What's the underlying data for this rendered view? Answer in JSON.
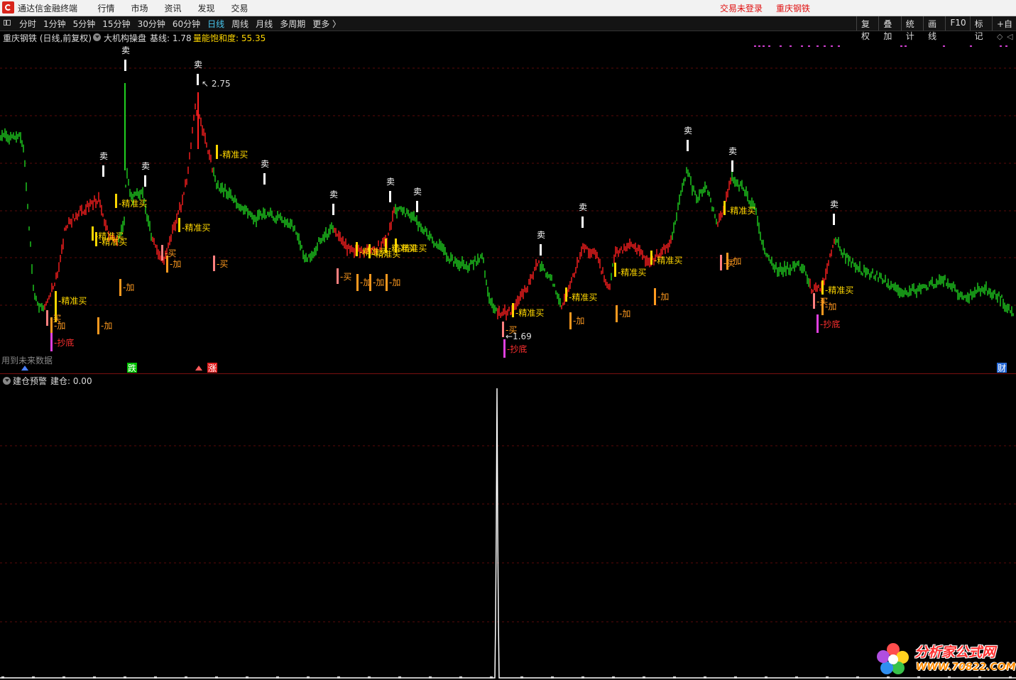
{
  "titlebar": {
    "app_name": "通达信金融终端",
    "menu": [
      "行情",
      "市场",
      "资讯",
      "发现",
      "交易"
    ],
    "status": "交易未登录",
    "stock": "重庆钢铁"
  },
  "periodbar": {
    "periods": [
      "分时",
      "1分钟",
      "5分钟",
      "15分钟",
      "30分钟",
      "60分钟",
      "日线",
      "周线",
      "月线",
      "多周期",
      "更多 〉"
    ],
    "active_index": 6,
    "tools": [
      "复权",
      "叠加",
      "统计",
      "画线",
      "F10",
      "标记",
      "+自"
    ]
  },
  "main": {
    "stock_label": "重庆钢铁 (日线,前复权)",
    "indicator_name": "大机构操盘",
    "base_label": "基线: 1.78",
    "saturation_label": "量能饱和度: 55.35",
    "future_note": "用到未来数据",
    "high_marker": "2.75",
    "low_marker": "1.69",
    "bottom_tags": [
      {
        "text": "跌",
        "color": "#00c000"
      },
      {
        "text": "涨",
        "color": "#e02020"
      },
      {
        "text": "财",
        "color": "#2a6cd8"
      }
    ],
    "signal_labels": {
      "sell": "卖",
      "precise_buy": "精准买",
      "add": "加",
      "buy": "买",
      "bottom": "抄底"
    },
    "colors": {
      "up": "#ff2020",
      "down": "#20d020",
      "sell": "#ffffff",
      "precise_buy": "#ffd700",
      "add": "#ff9a1f",
      "buy": "#ff8080",
      "bottom": "#e040e0",
      "grid": "#5a0a0a"
    }
  },
  "sub": {
    "name": "建仓预警",
    "value_label": "建仓: 0.00",
    "colors": {
      "line": "#ffffff",
      "grid": "#5a0a0a"
    }
  },
  "watermark": {
    "title": "分析家公式网",
    "url": "WWW.70822.COM"
  }
}
